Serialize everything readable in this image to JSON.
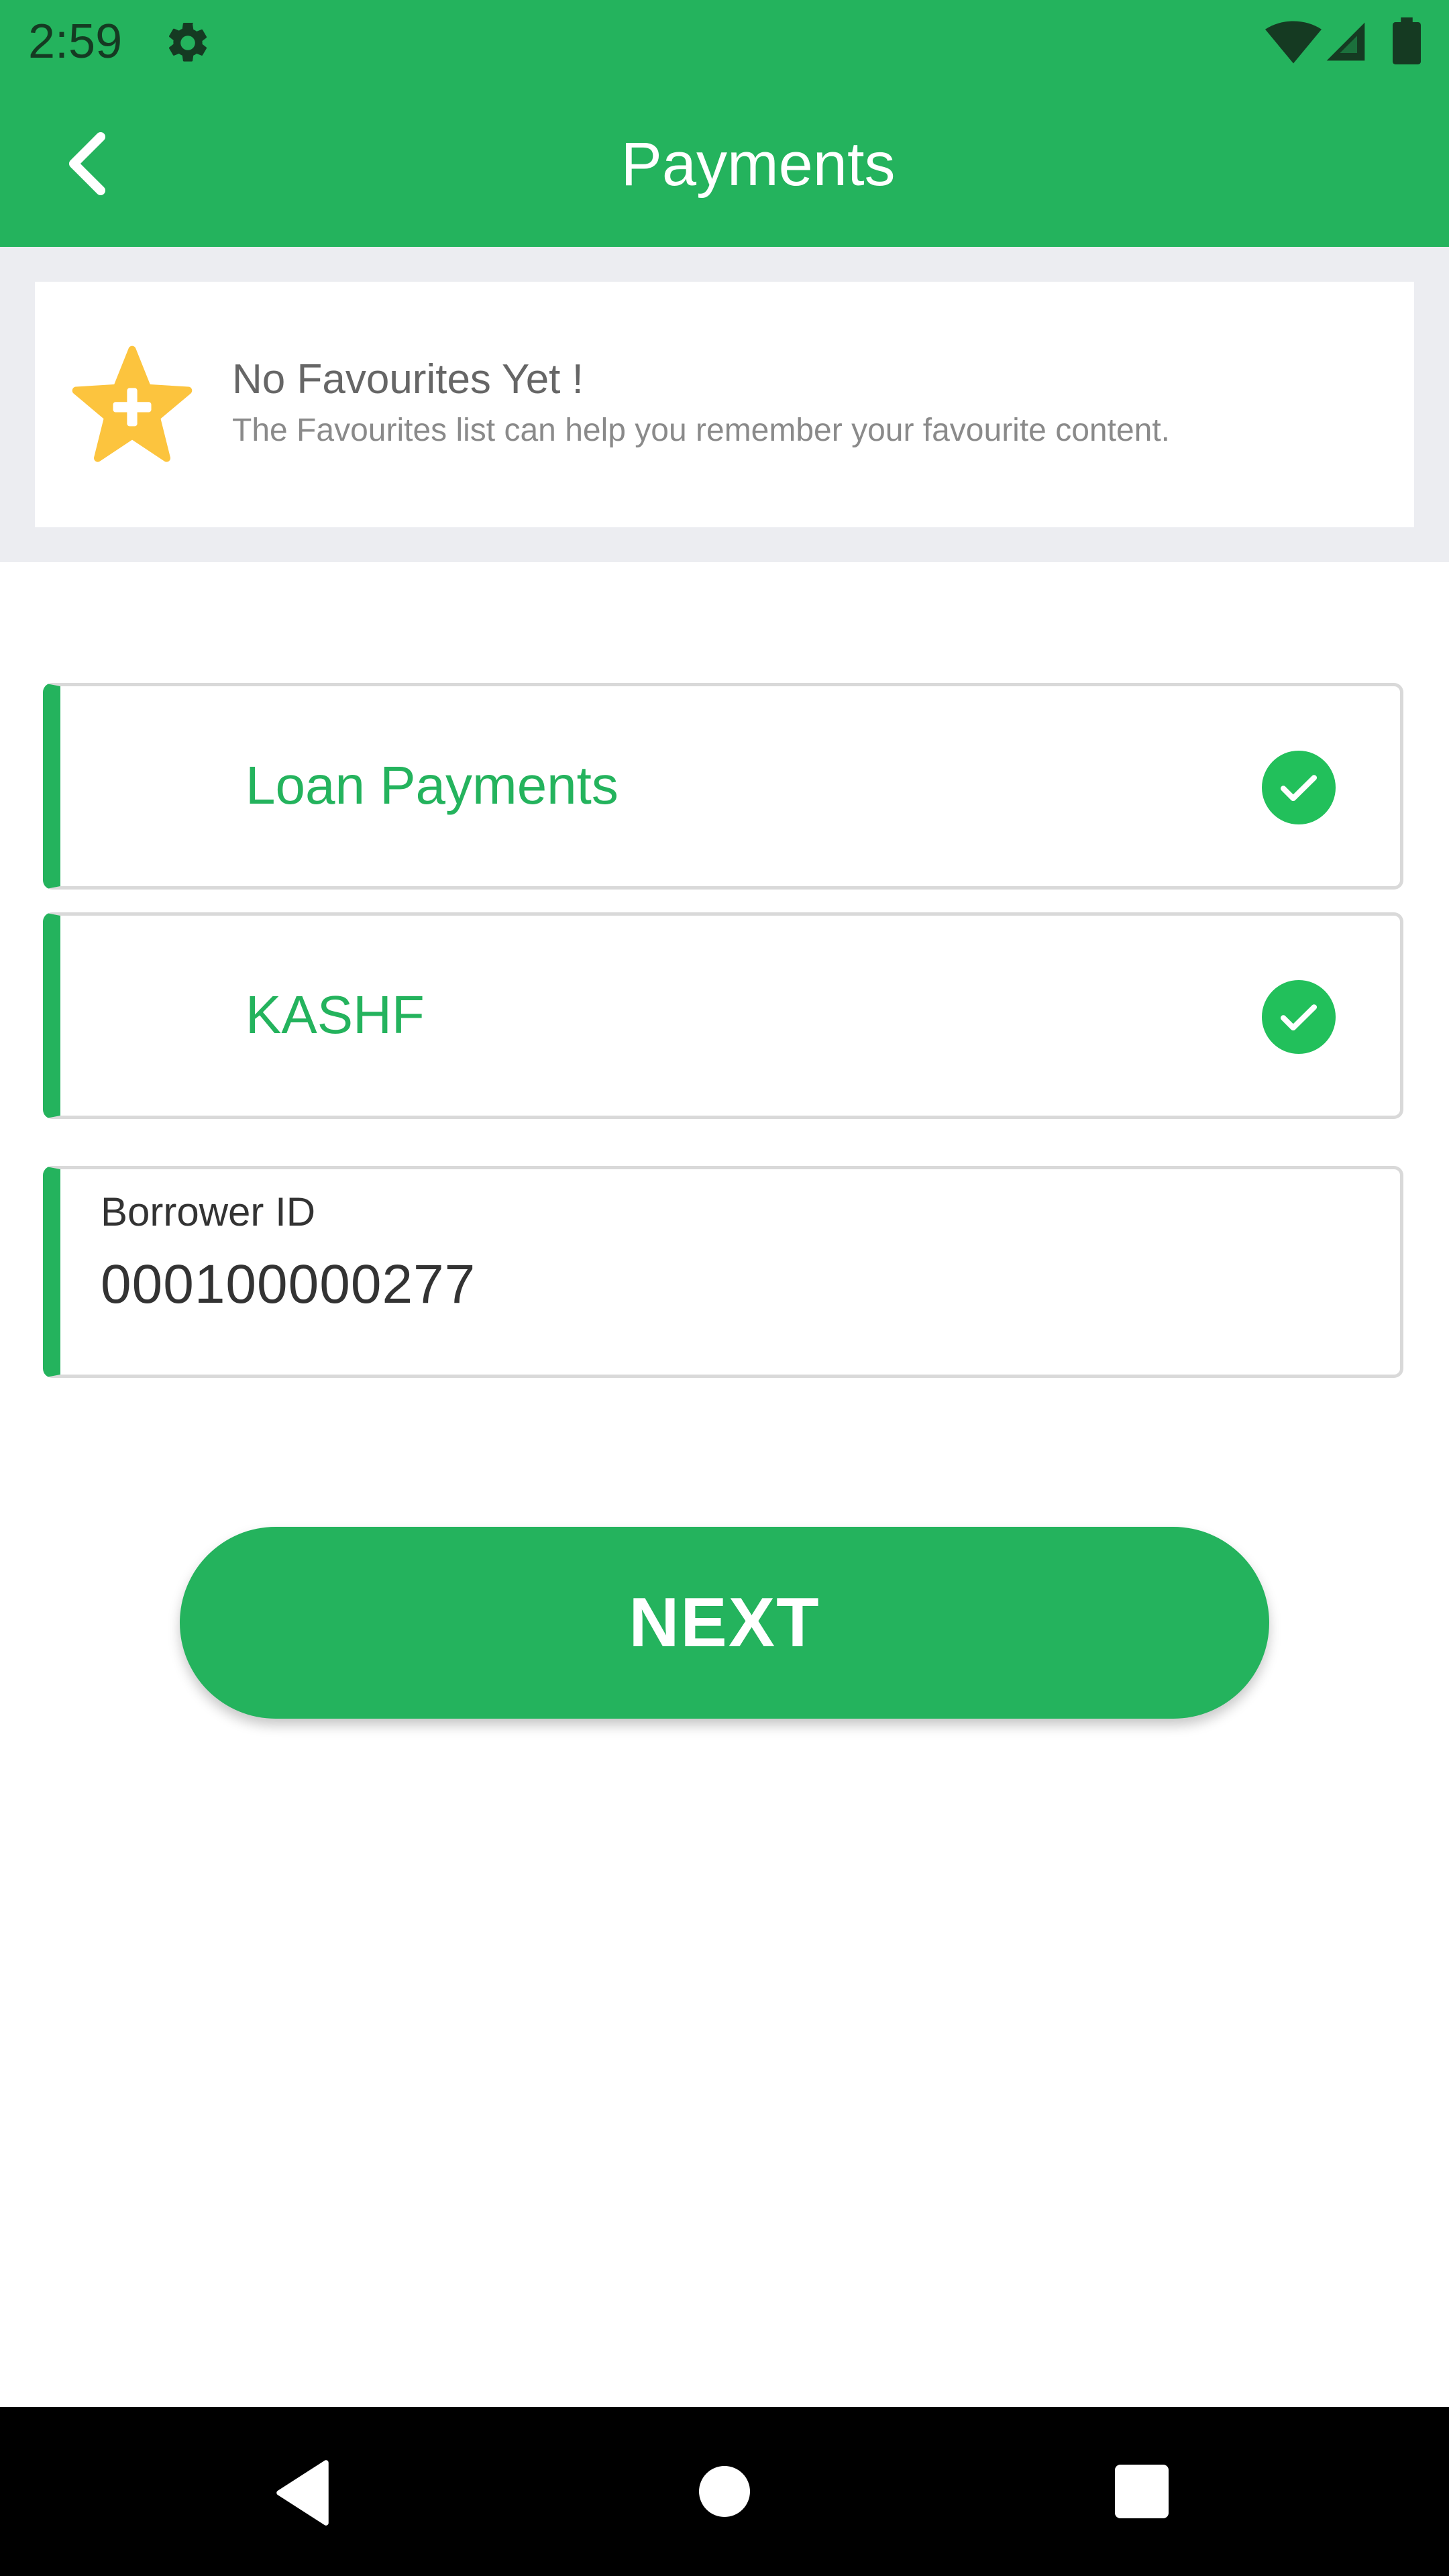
{
  "status_bar": {
    "time": "2:59",
    "icons": [
      "gear-icon",
      "wifi-icon",
      "cell-signal-icon",
      "battery-icon"
    ]
  },
  "toolbar": {
    "title": "Payments",
    "back_icon": "chevron-left-icon"
  },
  "favourites": {
    "icon": "star-plus-icon",
    "title": "No Favourites Yet !",
    "subtitle": "The Favourites list can help you remember your favourite content."
  },
  "options": [
    {
      "label": "Loan Payments",
      "icon": "check-circle-icon"
    },
    {
      "label": "KASHF",
      "icon": "check-circle-icon"
    }
  ],
  "borrower": {
    "label": "Borrower ID",
    "value": "000100000277"
  },
  "next_button": {
    "label": "NEXT"
  },
  "nav_bar": {
    "icons": [
      "back-triangle-icon",
      "home-circle-icon",
      "recents-square-icon"
    ]
  },
  "colors": {
    "primary": "#24b35d",
    "status_icons": "#153a22",
    "star": "#fcc43e",
    "check": "#22c05b",
    "background_grey": "#ecedf1"
  }
}
